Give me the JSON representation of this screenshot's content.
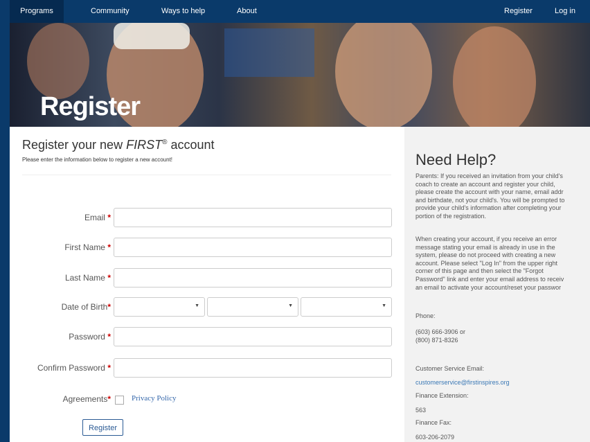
{
  "nav": {
    "left": [
      "Programs",
      "Community",
      "Ways to help",
      "About"
    ],
    "register": "Register",
    "login": "Log in"
  },
  "hero": {
    "title": "Register"
  },
  "form": {
    "heading_pre": "Register your new ",
    "heading_brand": "FIRST",
    "heading_sup": "®",
    "heading_post": " account",
    "intro": "Please enter the information below to register a new account!",
    "required_mark": "*",
    "labels": {
      "email": "Email",
      "first_name": "First Name",
      "last_name": "Last Name",
      "dob": "Date of Birth",
      "password": "Password",
      "confirm_password": "Confirm Password",
      "agreements": "Agreements"
    },
    "dob_caret": "▼",
    "privacy_policy": "Privacy Policy",
    "register_button": "Register"
  },
  "help": {
    "title": "Need Help?",
    "para1": "Parents: If you received an invitation from your child's\ncoach to create an account and register your child,\nplease create the account with your name, email addr\nand birthdate, not your child's. You will be prompted to\nprovide your child's information after completing your\nportion of the registration.",
    "para2": "When creating your account, if you receive an error\nmessage stating your email is already in use in the\nsystem, please do not proceed with creating a new\naccount. Please select \"Log In\" from the upper right\ncorner of this page and then select the \"Forgot\nPassword\" link and enter your email address to receiv\nan email to activate your account/reset your passwor",
    "phone_label": "Phone:",
    "phone_numbers": "(603) 666-3906 or\n(800) 871-8326",
    "cs_email_label": "Customer Service Email:",
    "cs_email": "customerservice@firstinspires.org",
    "finance_ext_label": "Finance Extension:",
    "finance_ext": "563",
    "finance_fax_label": "Finance Fax:",
    "finance_fax": "603-206-2079"
  },
  "colors": {
    "nav_bg": "#0a3a6a",
    "required": "#cc0000",
    "link": "#3a78b5"
  }
}
